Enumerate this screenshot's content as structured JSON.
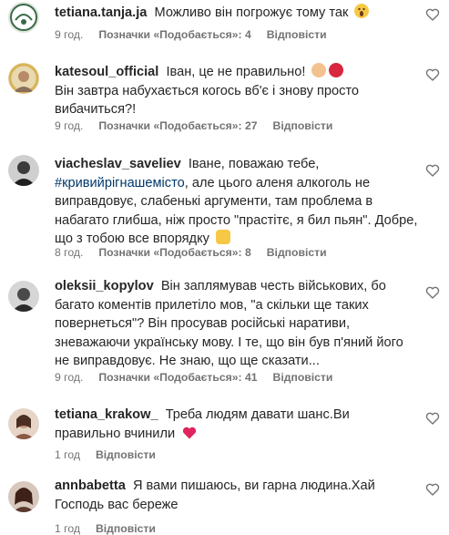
{
  "colors": {
    "link": "#00376b",
    "meta": "#737373",
    "text": "#262626",
    "like_heart": "#ed2f3c"
  },
  "comments": [
    {
      "username": "tetiana.tanja.ja",
      "text_1": "Можливо він погрожує тому так",
      "emoji": [
        "face-screaming-emoji"
      ],
      "time": "9 год.",
      "likes": "Позначки «Подобається»: 4",
      "reply": "Відповісти"
    },
    {
      "username": "katesoul_official",
      "text_1": "Іван, це не правильно!",
      "emoji": [
        "exploding-head-emoji",
        "angry-face-emoji"
      ],
      "text_2": "Він завтра набухається когось вб'є і знову просто вибачиться?!",
      "time": "9 год.",
      "likes": "Позначки «Подобається»: 27",
      "reply": "Відповісти"
    },
    {
      "username": "viacheslav_saveliev",
      "text_1": "Іване, поважаю тебе,",
      "hashtag": "#кривийрігнашемісто",
      "text_2": ", але цього аленя алкоголь не виправдовує, слабенькі аргументи, там проблема в набагато глибша, ніж просто \"прастітє, я бил пьян\". Добре, що з тобою все впорядку",
      "emoji": [
        "raising-hands-emoji"
      ],
      "time": "8 год.",
      "likes": "Позначки «Подобається»: 8",
      "reply": "Відповісти"
    },
    {
      "username": "oleksii_kopylov",
      "text_1": "Він заплямував честь військових, бо багато коментів прилетіло мов, \"а скільки ще таких повернеться\"? Він просував російські наративи, зневажаючи українську мову. І те, що він був п'яний його не виправдовує. Не знаю, що ще сказати...",
      "time": "9 год.",
      "likes": "Позначки «Подобається»: 41",
      "reply": "Відповісти"
    },
    {
      "username": "tetiana_krakow_",
      "text_1": "Треба людям давати шанс.Ви правильно вчинили",
      "emoji": [
        "red-heart-emoji"
      ],
      "time": "1 год",
      "reply": "Відповісти"
    },
    {
      "username": "annbabetta",
      "text_1": "Я вами пишаюсь, ви гарна людина.Хай Господь вас береже",
      "time": "1 год",
      "reply": "Відповісти"
    }
  ]
}
